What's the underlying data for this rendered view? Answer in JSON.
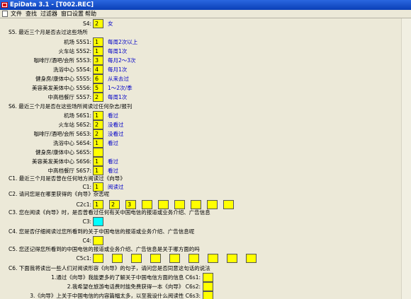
{
  "window": {
    "title": "EpiData 3.1 - [T002.REC]"
  },
  "menu": {
    "items": [
      "文件",
      "查找",
      "过滤器",
      "窗口设置",
      "帮助"
    ]
  },
  "s4": {
    "label": "S4:",
    "value": "2",
    "answer": "女"
  },
  "s5": {
    "heading": "S5. 最近三个月是否去过这些场所",
    "rows": [
      {
        "place": "机场 S5S1:",
        "value": "1",
        "answer": "每周2次以上"
      },
      {
        "place": "火车站 S5S2:",
        "value": "1",
        "answer": "每周1次"
      },
      {
        "place": "咖啡厅/酒吧/会所 S5S3:",
        "value": "3",
        "answer": "每月2～3次"
      },
      {
        "place": "洗浴中心 S5S4:",
        "value": "4",
        "answer": "每月1次"
      },
      {
        "place": "健身房/康体中心 S5S5:",
        "value": "6",
        "answer": "从来去过"
      },
      {
        "place": "美容美发美体中心 S5S6:",
        "value": "5",
        "answer": "1～2次/季"
      },
      {
        "place": "中高档餐厅 S5S7:",
        "value": "2",
        "answer": "每周1次"
      }
    ]
  },
  "s6": {
    "heading": "S6. 最近三个月是否在这些场所阅读过任何杂志/报刊",
    "rows": [
      {
        "place": "机场 S6S1:",
        "value": "1",
        "answer": "看过"
      },
      {
        "place": "火车站 S6S2:",
        "value": "2",
        "answer": "没看过"
      },
      {
        "place": "咖啡厅/酒吧/会所 S6S3:",
        "value": "2",
        "answer": "没看过"
      },
      {
        "place": "洗浴中心 S6S4:",
        "value": "1",
        "answer": "看过"
      },
      {
        "place": "健身房/康体中心 S6S5:",
        "value": "",
        "answer": ""
      },
      {
        "place": "美容美发美体中心 S6S6:",
        "value": "1",
        "answer": "看过"
      },
      {
        "place": "中高档餐厅 S6S7:",
        "value": "1",
        "answer": "看过"
      }
    ]
  },
  "c1": {
    "question": "C1. 最近三个月是否曾在任何地方阅读过《向导》",
    "label": "C1:",
    "value": "1",
    "answer": "阅读过"
  },
  "c2": {
    "question": "C2. 请问您是在哪里获得的《向导》杂志呢",
    "label": "C2c1:",
    "values": [
      "1",
      "2",
      "3",
      "",
      "",
      "",
      "",
      "",
      ""
    ]
  },
  "c3": {
    "question": "C3. 您在阅读《向导》时，是否曾看过任何有关中国电信的报道或业务介绍、广告信息",
    "label": "C3:",
    "value": ""
  },
  "c4": {
    "question": "C4. 您是否仔细阅读过您所看到的关于中国电信的报道或业务介绍、广告信息呢",
    "label": "C4:",
    "value": ""
  },
  "c5": {
    "question": "C5. 您还记得您所看到的中国电信的报道或业务介绍、广告信息是关于哪方面的吗",
    "label": "C5c1:",
    "values": [
      "",
      "",
      "",
      "",
      "",
      "",
      "",
      "",
      ""
    ]
  },
  "c6": {
    "question": "C6. 下面我将读出一些人们对阅读形容《向导》的句子，请问您是否同意这句话的说法",
    "rows": [
      {
        "text": "1.通过《向导》我能更多的了解关于中国电信方面的信息 C6s1:",
        "value": ""
      },
      {
        "text": "2.我希望在旅游电话费时能免费获得一本《向导》 C6s2:",
        "value": ""
      },
      {
        "text": "3.《向导》上关于中国电信的内容篇幅太多，以至我设什么阅读性 C6s3:",
        "value": ""
      }
    ]
  }
}
